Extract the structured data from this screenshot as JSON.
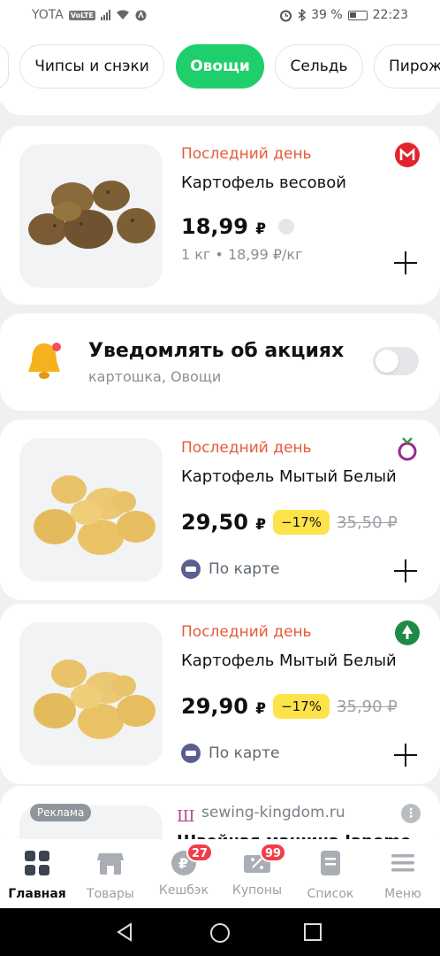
{
  "status_bar": {
    "carrier": "YOTA",
    "volte": "VoLTE",
    "battery": "39 %",
    "time": "22:23"
  },
  "categories": {
    "chips": [
      "Чипсы и снэки",
      "Овощи",
      "Сельдь",
      "Пирож"
    ],
    "active": "Овощи"
  },
  "products": [
    {
      "badge": "Последний день",
      "name": "Картофель весовой",
      "price": "18,99",
      "currency": "₽",
      "unit_line": "1 кг • 18,99 ₽/кг",
      "store_icon": "magnit-logo-icon"
    },
    {
      "badge": "Последний день",
      "name": "Картофель Мытый Белый",
      "price": "29,50",
      "currency": "₽",
      "discount": "−17%",
      "old_price": "35,50 ₽",
      "by_card": "По карте",
      "store_icon": "berry-logo-icon"
    },
    {
      "badge": "Последний день",
      "name": "Картофель Мытый Белый",
      "price": "29,90",
      "currency": "₽",
      "discount": "−17%",
      "old_price": "35,90 ₽",
      "by_card": "По карте",
      "store_icon": "spar-logo-icon"
    }
  ],
  "notify": {
    "title": "Уведомлять об акциях",
    "subtitle": "картошка, Овощи",
    "enabled": false
  },
  "ad": {
    "label": "Реклама",
    "host": "sewing-kingdom.ru",
    "title": "Швейная машина Janome"
  },
  "bottom_nav": [
    {
      "label": "Главная",
      "icon": "grid-icon",
      "active": true
    },
    {
      "label": "Товары",
      "icon": "shop-icon"
    },
    {
      "label": "Кешбэк",
      "icon": "cashback-icon",
      "badge": "27"
    },
    {
      "label": "Купоны",
      "icon": "coupon-icon",
      "badge": "99"
    },
    {
      "label": "Список",
      "icon": "list-icon"
    },
    {
      "label": "Меню",
      "icon": "menu-icon"
    }
  ],
  "colors": {
    "accent": "#1fcf6c",
    "badge_text": "#e55a3b",
    "discount_bg": "#fde34a",
    "notification_badge": "#f23d4a"
  }
}
